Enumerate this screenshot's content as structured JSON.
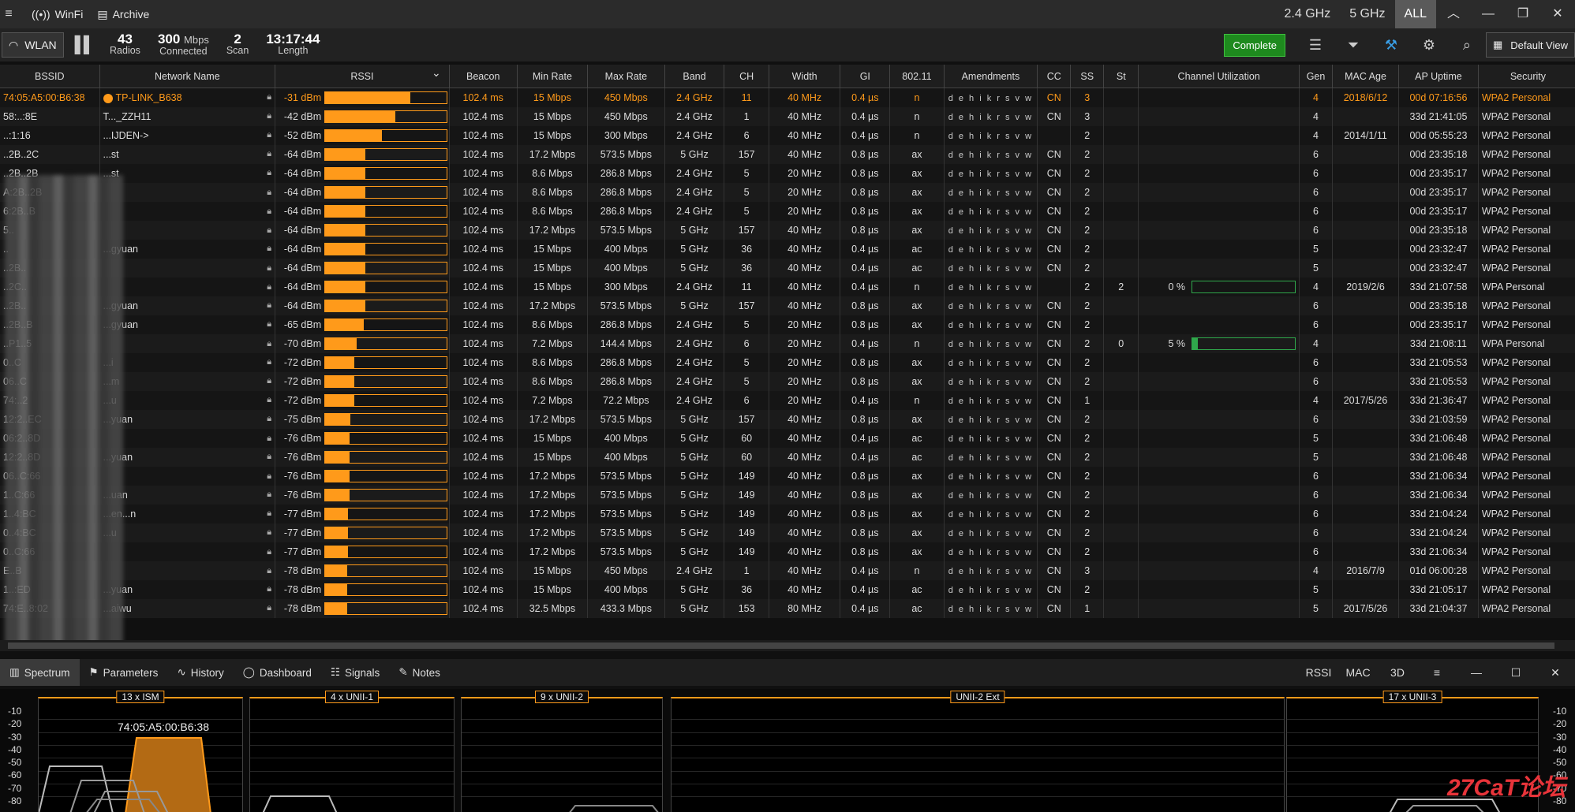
{
  "titlebar": {
    "app": "WinFi",
    "archive": "Archive",
    "bands": [
      "2.4 GHz",
      "5 GHz",
      "ALL"
    ]
  },
  "toolbar": {
    "wlan": "WLAN",
    "radios": {
      "value": "43",
      "label": "Radios"
    },
    "connected": {
      "value": "300",
      "unit": "Mbps",
      "label": "Connected"
    },
    "scan": {
      "value": "2",
      "label": "Scan"
    },
    "length": {
      "value": "13:17:44",
      "label": "Length"
    },
    "complete": "Complete",
    "default_view": "Default View"
  },
  "columns": [
    "BSSID",
    "Network Name",
    "RSSI",
    "Beacon",
    "Min Rate",
    "Max Rate",
    "Band",
    "CH",
    "Width",
    "GI",
    "802.11",
    "Amendments",
    "CC",
    "SS",
    "St",
    "Channel Utilization",
    "Gen",
    "MAC Age",
    "AP Uptime",
    "Security"
  ],
  "rows": [
    {
      "bssid": "74:05:A5:00:B6:38",
      "name": "TP-LINK_B638",
      "rssi": "-31 dBm",
      "pct": 0.7,
      "beacon": "102.4 ms",
      "min": "15 Mbps",
      "max": "450 Mbps",
      "band": "2.4 GHz",
      "ch": "11",
      "width": "40 MHz",
      "gi": "0.4 µs",
      "std": "n",
      "cc": "CN",
      "ss": "3",
      "st": "",
      "util": "",
      "up": "",
      "gen": "4",
      "age": "2018/6/12",
      "uptime": "00d 07:16:56",
      "sec": "WPA2 Personal"
    },
    {
      "bssid": "58:..:8E",
      "name": "T..._ZZH11",
      "rssi": "-42 dBm",
      "pct": 0.58,
      "beacon": "102.4 ms",
      "min": "15 Mbps",
      "max": "450 Mbps",
      "band": "2.4 GHz",
      "ch": "1",
      "width": "40 MHz",
      "gi": "0.4 µs",
      "std": "n",
      "cc": "CN",
      "ss": "3",
      "st": "",
      "util": "",
      "up": "",
      "gen": "4",
      "age": "",
      "uptime": "33d 21:41:05",
      "sec": "WPA2 Personal"
    },
    {
      "bssid": "..:1:16",
      "name": "...IJDEN->",
      "rssi": "-52 dBm",
      "pct": 0.47,
      "beacon": "102.4 ms",
      "min": "15 Mbps",
      "max": "300 Mbps",
      "band": "2.4 GHz",
      "ch": "6",
      "width": "40 MHz",
      "gi": "0.4 µs",
      "std": "n",
      "cc": "",
      "ss": "2",
      "st": "",
      "util": "",
      "up": "",
      "gen": "4",
      "age": "2014/1/11",
      "uptime": "00d 05:55:23",
      "sec": "WPA2 Personal"
    },
    {
      "bssid": "..2B..2C",
      "name": "...st",
      "rssi": "-64 dBm",
      "pct": 0.33,
      "beacon": "102.4 ms",
      "min": "17.2 Mbps",
      "max": "573.5 Mbps",
      "band": "5 GHz",
      "ch": "157",
      "width": "40 MHz",
      "gi": "0.8 µs",
      "std": "ax",
      "cc": "CN",
      "ss": "2",
      "st": "",
      "util": "",
      "up": "",
      "gen": "6",
      "age": "",
      "uptime": "00d 23:35:18",
      "sec": "WPA2 Personal"
    },
    {
      "bssid": "..2B..2B",
      "name": "...st",
      "rssi": "-64 dBm",
      "pct": 0.33,
      "beacon": "102.4 ms",
      "min": "8.6 Mbps",
      "max": "286.8 Mbps",
      "band": "2.4 GHz",
      "ch": "5",
      "width": "20 MHz",
      "gi": "0.8 µs",
      "std": "ax",
      "cc": "CN",
      "ss": "2",
      "st": "",
      "util": "",
      "up": "",
      "gen": "6",
      "age": "",
      "uptime": "00d 23:35:17",
      "sec": "WPA2 Personal"
    },
    {
      "bssid": "A:2B..2B",
      "name": "",
      "rssi": "-64 dBm",
      "pct": 0.33,
      "beacon": "102.4 ms",
      "min": "8.6 Mbps",
      "max": "286.8 Mbps",
      "band": "2.4 GHz",
      "ch": "5",
      "width": "20 MHz",
      "gi": "0.8 µs",
      "std": "ax",
      "cc": "CN",
      "ss": "2",
      "st": "",
      "util": "",
      "up": "",
      "gen": "6",
      "age": "",
      "uptime": "00d 23:35:17",
      "sec": "WPA2 Personal"
    },
    {
      "bssid": "6:2B..B",
      "name": "",
      "rssi": "-64 dBm",
      "pct": 0.33,
      "beacon": "102.4 ms",
      "min": "8.6 Mbps",
      "max": "286.8 Mbps",
      "band": "2.4 GHz",
      "ch": "5",
      "width": "20 MHz",
      "gi": "0.8 µs",
      "std": "ax",
      "cc": "CN",
      "ss": "2",
      "st": "",
      "util": "",
      "up": "",
      "gen": "6",
      "age": "",
      "uptime": "00d 23:35:17",
      "sec": "WPA2 Personal"
    },
    {
      "bssid": "5..",
      "name": "",
      "rssi": "-64 dBm",
      "pct": 0.33,
      "beacon": "102.4 ms",
      "min": "17.2 Mbps",
      "max": "573.5 Mbps",
      "band": "5 GHz",
      "ch": "157",
      "width": "40 MHz",
      "gi": "0.8 µs",
      "std": "ax",
      "cc": "CN",
      "ss": "2",
      "st": "",
      "util": "",
      "up": "",
      "gen": "6",
      "age": "",
      "uptime": "00d 23:35:18",
      "sec": "WPA2 Personal"
    },
    {
      "bssid": "..",
      "name": "...gyuan",
      "rssi": "-64 dBm",
      "pct": 0.33,
      "beacon": "102.4 ms",
      "min": "15 Mbps",
      "max": "400 Mbps",
      "band": "5 GHz",
      "ch": "36",
      "width": "40 MHz",
      "gi": "0.4 µs",
      "std": "ac",
      "cc": "CN",
      "ss": "2",
      "st": "",
      "util": "",
      "up": "",
      "gen": "5",
      "age": "",
      "uptime": "00d 23:32:47",
      "sec": "WPA2 Personal"
    },
    {
      "bssid": "..2B..",
      "name": "",
      "rssi": "-64 dBm",
      "pct": 0.33,
      "beacon": "102.4 ms",
      "min": "15 Mbps",
      "max": "400 Mbps",
      "band": "5 GHz",
      "ch": "36",
      "width": "40 MHz",
      "gi": "0.4 µs",
      "std": "ac",
      "cc": "CN",
      "ss": "2",
      "st": "",
      "util": "",
      "up": "",
      "gen": "5",
      "age": "",
      "uptime": "00d 23:32:47",
      "sec": "WPA2 Personal"
    },
    {
      "bssid": "..2C..",
      "name": "",
      "rssi": "-64 dBm",
      "pct": 0.33,
      "beacon": "102.4 ms",
      "min": "15 Mbps",
      "max": "300 Mbps",
      "band": "2.4 GHz",
      "ch": "11",
      "width": "40 MHz",
      "gi": "0.4 µs",
      "std": "n",
      "cc": "",
      "ss": "2",
      "st": "2",
      "util": "0 %",
      "up": 0.0,
      "gen": "4",
      "age": "2019/2/6",
      "uptime": "33d 21:07:58",
      "sec": "WPA Personal"
    },
    {
      "bssid": "..2B..",
      "name": "...gyuan",
      "rssi": "-64 dBm",
      "pct": 0.33,
      "beacon": "102.4 ms",
      "min": "17.2 Mbps",
      "max": "573.5 Mbps",
      "band": "5 GHz",
      "ch": "157",
      "width": "40 MHz",
      "gi": "0.8 µs",
      "std": "ax",
      "cc": "CN",
      "ss": "2",
      "st": "",
      "util": "",
      "up": "",
      "gen": "6",
      "age": "",
      "uptime": "00d 23:35:18",
      "sec": "WPA2 Personal"
    },
    {
      "bssid": "..2B..B",
      "name": "...gyuan",
      "rssi": "-65 dBm",
      "pct": 0.32,
      "beacon": "102.4 ms",
      "min": "8.6 Mbps",
      "max": "286.8 Mbps",
      "band": "2.4 GHz",
      "ch": "5",
      "width": "20 MHz",
      "gi": "0.8 µs",
      "std": "ax",
      "cc": "CN",
      "ss": "2",
      "st": "",
      "util": "",
      "up": "",
      "gen": "6",
      "age": "",
      "uptime": "00d 23:35:17",
      "sec": "WPA2 Personal"
    },
    {
      "bssid": "..P1..5",
      "name": "",
      "rssi": "-70 dBm",
      "pct": 0.26,
      "beacon": "102.4 ms",
      "min": "7.2 Mbps",
      "max": "144.4 Mbps",
      "band": "2.4 GHz",
      "ch": "6",
      "width": "20 MHz",
      "gi": "0.4 µs",
      "std": "n",
      "cc": "CN",
      "ss": "2",
      "st": "0",
      "util": "5 %",
      "up": 0.05,
      "gen": "4",
      "age": "",
      "uptime": "33d 21:08:11",
      "sec": "WPA Personal"
    },
    {
      "bssid": "0..C",
      "name": "...i",
      "rssi": "-72 dBm",
      "pct": 0.24,
      "beacon": "102.4 ms",
      "min": "8.6 Mbps",
      "max": "286.8 Mbps",
      "band": "2.4 GHz",
      "ch": "5",
      "width": "20 MHz",
      "gi": "0.8 µs",
      "std": "ax",
      "cc": "CN",
      "ss": "2",
      "st": "",
      "util": "",
      "up": "",
      "gen": "6",
      "age": "",
      "uptime": "33d 21:05:53",
      "sec": "WPA2 Personal"
    },
    {
      "bssid": "06..C",
      "name": "...m",
      "rssi": "-72 dBm",
      "pct": 0.24,
      "beacon": "102.4 ms",
      "min": "8.6 Mbps",
      "max": "286.8 Mbps",
      "band": "2.4 GHz",
      "ch": "5",
      "width": "20 MHz",
      "gi": "0.8 µs",
      "std": "ax",
      "cc": "CN",
      "ss": "2",
      "st": "",
      "util": "",
      "up": "",
      "gen": "6",
      "age": "",
      "uptime": "33d 21:05:53",
      "sec": "WPA2 Personal"
    },
    {
      "bssid": "74:..2",
      "name": "...u",
      "rssi": "-72 dBm",
      "pct": 0.24,
      "beacon": "102.4 ms",
      "min": "7.2 Mbps",
      "max": "72.2 Mbps",
      "band": "2.4 GHz",
      "ch": "6",
      "width": "20 MHz",
      "gi": "0.4 µs",
      "std": "n",
      "cc": "CN",
      "ss": "1",
      "st": "",
      "util": "",
      "up": "",
      "gen": "4",
      "age": "2017/5/26",
      "uptime": "33d 21:36:47",
      "sec": "WPA2 Personal"
    },
    {
      "bssid": "12:2..EC",
      "name": "...yuan",
      "rssi": "-75 dBm",
      "pct": 0.21,
      "beacon": "102.4 ms",
      "min": "17.2 Mbps",
      "max": "573.5 Mbps",
      "band": "5 GHz",
      "ch": "157",
      "width": "40 MHz",
      "gi": "0.8 µs",
      "std": "ax",
      "cc": "CN",
      "ss": "2",
      "st": "",
      "util": "",
      "up": "",
      "gen": "6",
      "age": "",
      "uptime": "33d 21:03:59",
      "sec": "WPA2 Personal"
    },
    {
      "bssid": "06:2..8D",
      "name": "",
      "rssi": "-76 dBm",
      "pct": 0.2,
      "beacon": "102.4 ms",
      "min": "15 Mbps",
      "max": "400 Mbps",
      "band": "5 GHz",
      "ch": "60",
      "width": "40 MHz",
      "gi": "0.4 µs",
      "std": "ac",
      "cc": "CN",
      "ss": "2",
      "st": "",
      "util": "",
      "up": "",
      "gen": "5",
      "age": "",
      "uptime": "33d 21:06:48",
      "sec": "WPA2 Personal"
    },
    {
      "bssid": "12:2..8D",
      "name": "...yuan",
      "rssi": "-76 dBm",
      "pct": 0.2,
      "beacon": "102.4 ms",
      "min": "15 Mbps",
      "max": "400 Mbps",
      "band": "5 GHz",
      "ch": "60",
      "width": "40 MHz",
      "gi": "0.4 µs",
      "std": "ac",
      "cc": "CN",
      "ss": "2",
      "st": "",
      "util": "",
      "up": "",
      "gen": "5",
      "age": "",
      "uptime": "33d 21:06:48",
      "sec": "WPA2 Personal"
    },
    {
      "bssid": "06..C:66",
      "name": "",
      "rssi": "-76 dBm",
      "pct": 0.2,
      "beacon": "102.4 ms",
      "min": "17.2 Mbps",
      "max": "573.5 Mbps",
      "band": "5 GHz",
      "ch": "149",
      "width": "40 MHz",
      "gi": "0.8 µs",
      "std": "ax",
      "cc": "CN",
      "ss": "2",
      "st": "",
      "util": "",
      "up": "",
      "gen": "6",
      "age": "",
      "uptime": "33d 21:06:34",
      "sec": "WPA2 Personal"
    },
    {
      "bssid": "1..C:66",
      "name": "...uan",
      "rssi": "-76 dBm",
      "pct": 0.2,
      "beacon": "102.4 ms",
      "min": "17.2 Mbps",
      "max": "573.5 Mbps",
      "band": "5 GHz",
      "ch": "149",
      "width": "40 MHz",
      "gi": "0.8 µs",
      "std": "ax",
      "cc": "CN",
      "ss": "2",
      "st": "",
      "util": "",
      "up": "",
      "gen": "6",
      "age": "",
      "uptime": "33d 21:06:34",
      "sec": "WPA2 Personal"
    },
    {
      "bssid": "1..4:BC",
      "name": "...en...n",
      "rssi": "-77 dBm",
      "pct": 0.19,
      "beacon": "102.4 ms",
      "min": "17.2 Mbps",
      "max": "573.5 Mbps",
      "band": "5 GHz",
      "ch": "149",
      "width": "40 MHz",
      "gi": "0.8 µs",
      "std": "ax",
      "cc": "CN",
      "ss": "2",
      "st": "",
      "util": "",
      "up": "",
      "gen": "6",
      "age": "",
      "uptime": "33d 21:04:24",
      "sec": "WPA2 Personal"
    },
    {
      "bssid": "0..4:BC",
      "name": "...u",
      "rssi": "-77 dBm",
      "pct": 0.19,
      "beacon": "102.4 ms",
      "min": "17.2 Mbps",
      "max": "573.5 Mbps",
      "band": "5 GHz",
      "ch": "149",
      "width": "40 MHz",
      "gi": "0.8 µs",
      "std": "ax",
      "cc": "CN",
      "ss": "2",
      "st": "",
      "util": "",
      "up": "",
      "gen": "6",
      "age": "",
      "uptime": "33d 21:04:24",
      "sec": "WPA2 Personal"
    },
    {
      "bssid": "0..C:66",
      "name": "",
      "rssi": "-77 dBm",
      "pct": 0.19,
      "beacon": "102.4 ms",
      "min": "17.2 Mbps",
      "max": "573.5 Mbps",
      "band": "5 GHz",
      "ch": "149",
      "width": "40 MHz",
      "gi": "0.8 µs",
      "std": "ax",
      "cc": "CN",
      "ss": "2",
      "st": "",
      "util": "",
      "up": "",
      "gen": "6",
      "age": "",
      "uptime": "33d 21:06:34",
      "sec": "WPA2 Personal"
    },
    {
      "bssid": "E..B",
      "name": "",
      "rssi": "-78 dBm",
      "pct": 0.18,
      "beacon": "102.4 ms",
      "min": "15 Mbps",
      "max": "450 Mbps",
      "band": "2.4 GHz",
      "ch": "1",
      "width": "40 MHz",
      "gi": "0.4 µs",
      "std": "n",
      "cc": "CN",
      "ss": "3",
      "st": "",
      "util": "",
      "up": "",
      "gen": "4",
      "age": "2016/7/9",
      "uptime": "01d 06:00:28",
      "sec": "WPA2 Personal"
    },
    {
      "bssid": "1..:ED",
      "name": "...yuan",
      "rssi": "-78 dBm",
      "pct": 0.18,
      "beacon": "102.4 ms",
      "min": "15 Mbps",
      "max": "400 Mbps",
      "band": "5 GHz",
      "ch": "36",
      "width": "40 MHz",
      "gi": "0.4 µs",
      "std": "ac",
      "cc": "CN",
      "ss": "2",
      "st": "",
      "util": "",
      "up": "",
      "gen": "5",
      "age": "",
      "uptime": "33d 21:05:17",
      "sec": "WPA2 Personal"
    },
    {
      "bssid": "74:E..8:02",
      "name": "...aiwu",
      "rssi": "-78 dBm",
      "pct": 0.18,
      "beacon": "102.4 ms",
      "min": "32.5 Mbps",
      "max": "433.3 Mbps",
      "band": "5 GHz",
      "ch": "153",
      "width": "80 MHz",
      "gi": "0.4 µs",
      "std": "ac",
      "cc": "CN",
      "ss": "1",
      "st": "",
      "util": "",
      "up": "",
      "gen": "5",
      "age": "2017/5/26",
      "uptime": "33d 21:04:37",
      "sec": "WPA2 Personal"
    }
  ],
  "amendments": "d e h i k r s v w",
  "tabs": [
    "Spectrum",
    "Parameters",
    "History",
    "Dashboard",
    "Signals",
    "Notes"
  ],
  "tab_right": [
    "RSSI",
    "MAC",
    "3D"
  ],
  "spectrum": {
    "yticks": [
      "-10",
      "-20",
      "-30",
      "-40",
      "-50",
      "-60",
      "-70",
      "-80"
    ],
    "bands": [
      "13 x ISM",
      "4 x UNII-1",
      "9 x UNII-2",
      "UNII-2 Ext",
      "17 x UNII-3"
    ],
    "label": "74:05:A5:00:B6:38"
  },
  "watermark": "27CaT论坛",
  "colors": {
    "accent": "#ff9a1a",
    "util": "#2fa84b",
    "complete": "#1e8a1e"
  }
}
